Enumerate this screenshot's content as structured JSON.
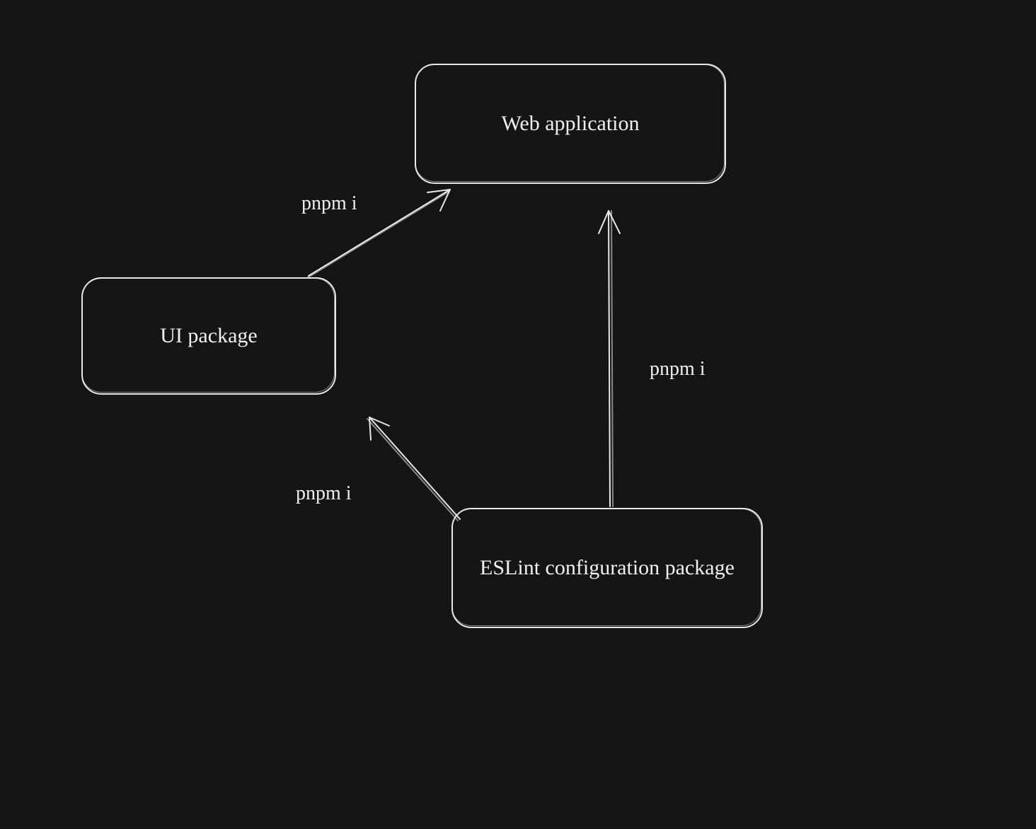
{
  "nodes": {
    "web_app": {
      "label": "Web application"
    },
    "ui_pkg": {
      "label": "UI package"
    },
    "eslint_pkg": {
      "label": "ESLint configuration package"
    }
  },
  "edges": {
    "ui_to_web": {
      "label": "pnpm i"
    },
    "eslint_to_ui": {
      "label": "pnpm i"
    },
    "eslint_to_web": {
      "label": "pnpm i"
    }
  },
  "colors": {
    "background": "#151515",
    "stroke": "#e8e8e8",
    "text": "#f0f0f0"
  }
}
